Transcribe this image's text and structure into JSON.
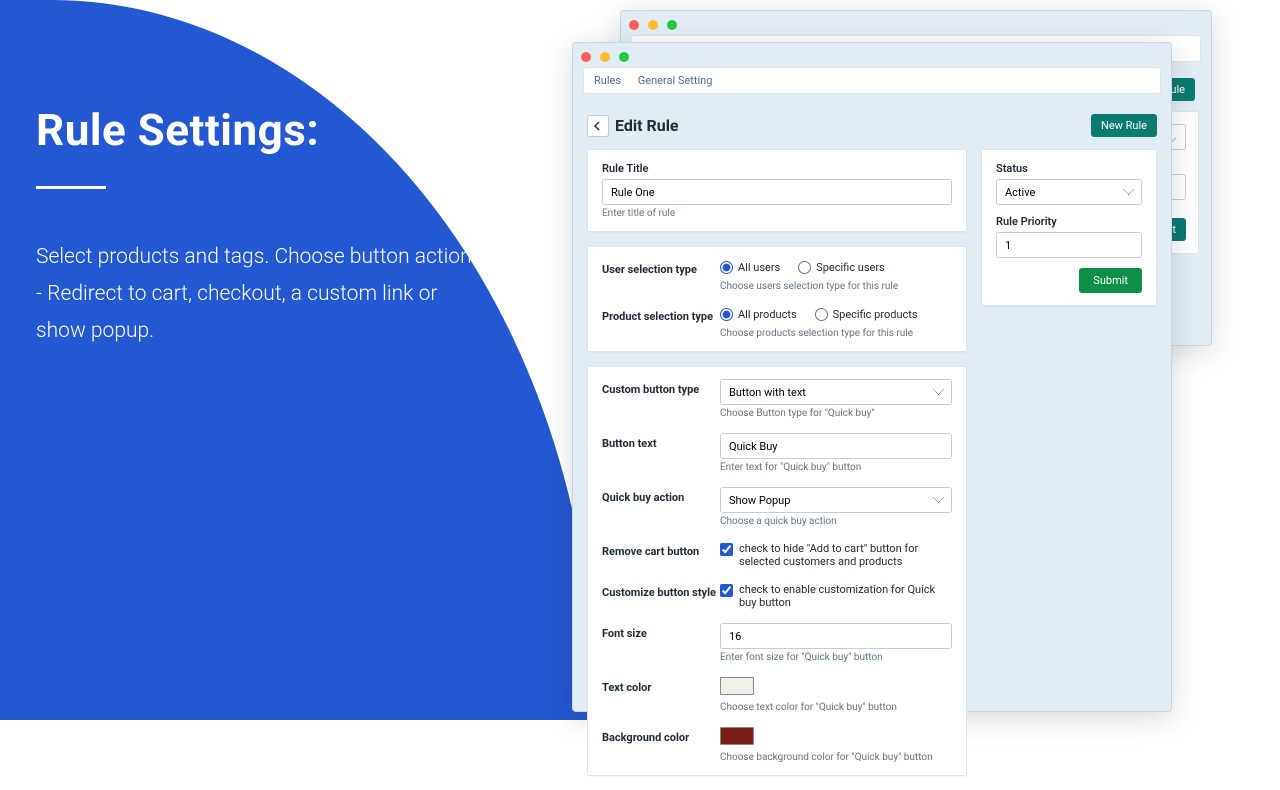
{
  "promo": {
    "heading": "Rule Settings:",
    "body": "Select products and tags. Choose button action - Redirect to cart, checkout, a custom link or show popup."
  },
  "tabs": {
    "rules": "Rules",
    "general": "General Setting"
  },
  "buttons": {
    "new_rule": "New Rule",
    "submit": "Submit"
  },
  "page_title": "Edit Rule",
  "rule_title": {
    "label": "Rule Title",
    "value": "Rule One",
    "help": "Enter title of rule"
  },
  "status": {
    "label": "Status",
    "value": "Active"
  },
  "priority": {
    "label": "Rule Priority",
    "value": "1"
  },
  "user_sel": {
    "label": "User selection type",
    "opt_all": "All users",
    "opt_specific": "Specific users",
    "help": "Choose users selection type for this rule"
  },
  "product_sel": {
    "label": "Product selection type",
    "opt_all": "All products",
    "opt_specific": "Specific products",
    "help": "Choose products selection type for this rule"
  },
  "btn_type": {
    "label": "Custom button type",
    "value": "Button with text",
    "help": "Choose Button type for \"Quick buy\""
  },
  "btn_text": {
    "label": "Button text",
    "value": "Quick Buy",
    "help": "Enter text for \"Quick buy\" button"
  },
  "action": {
    "label": "Quick buy action",
    "value": "Show Popup",
    "help": "Choose a quick buy action"
  },
  "remove_cart": {
    "label": "Remove cart button",
    "text": "check to hide \"Add to cart\" button for selected customers and products"
  },
  "customize": {
    "label": "Customize button style",
    "text": "check to enable customization for Quick buy button"
  },
  "font_size": {
    "label": "Font size",
    "value": "16",
    "help": "Enter font size for \"Quick buy\" button"
  },
  "text_color": {
    "label": "Text color",
    "help": "Choose text color for \"Quick buy\" button"
  },
  "bg_color": {
    "label": "Background color",
    "help": "Choose background color for \"Quick buy\" button"
  }
}
